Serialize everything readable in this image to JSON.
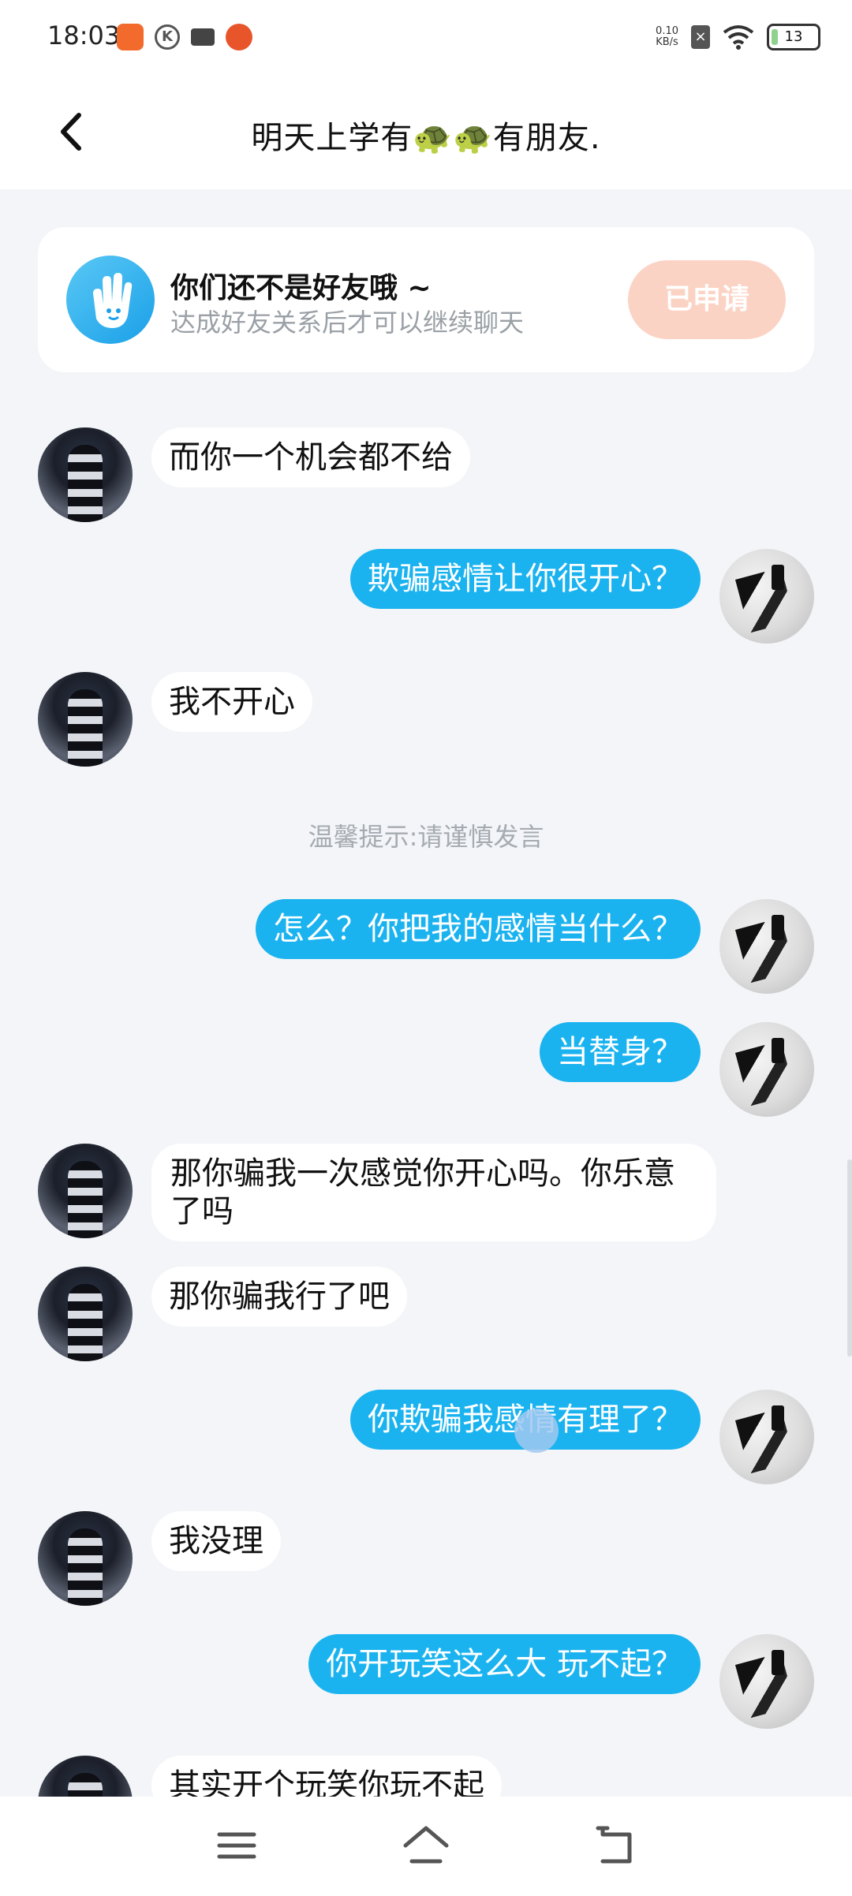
{
  "status_bar": {
    "time": "18:03",
    "net_speed_value": "0.10",
    "net_speed_unit": "KB/s",
    "battery": "13",
    "icons": [
      "orange-app-icon",
      "k-app-icon",
      "video-camera-icon",
      "pumpkin-app-icon",
      "network-speed",
      "notification-x-icon",
      "wifi-icon",
      "battery-icon"
    ]
  },
  "header": {
    "title": "明天上学有🐢🐢有朋友.",
    "back_icon": "chevron-left-icon"
  },
  "friend_card": {
    "title": "你们还不是好友哦 ~",
    "subtitle": "达成好友关系后才可以继续聊天",
    "button_label": "已申请",
    "icon": "hand-wave-icon"
  },
  "tip": "温馨提示:请谨慎发言",
  "messages": [
    {
      "side": "left",
      "text": "而你一个机会都不给"
    },
    {
      "side": "right",
      "text": "欺骗感情让你很开心？"
    },
    {
      "side": "left",
      "text": "我不开心"
    },
    {
      "side": "right",
      "text": "怎么？你把我的感情当什么？"
    },
    {
      "side": "right",
      "text": "当替身？"
    },
    {
      "side": "left",
      "text": "那你骗我一次感觉你开心吗。你乐意了吗"
    },
    {
      "side": "left",
      "text": "那你骗我行了吧"
    },
    {
      "side": "right",
      "text": "你欺骗我感情有理了？"
    },
    {
      "side": "left",
      "text": "我没理"
    },
    {
      "side": "right",
      "text": "你开玩笑这么大 玩不起？"
    },
    {
      "side": "left",
      "text": "其实开个玩笑你玩不起"
    }
  ],
  "colors": {
    "accent_blue": "#1bb3ef",
    "applied_button": "#fbd3c4",
    "background": "#f3f5f8"
  },
  "nav_bar": {
    "icons": [
      "menu-icon",
      "home-icon",
      "back-icon"
    ]
  }
}
